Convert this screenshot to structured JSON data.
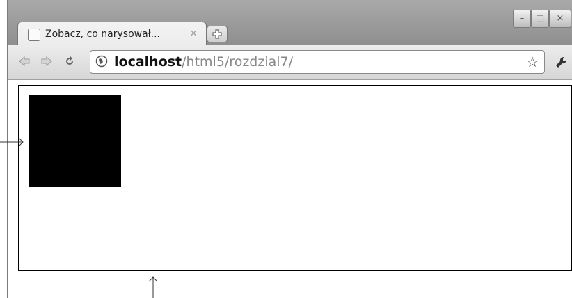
{
  "tab": {
    "title": "Zobacz, co narysował...",
    "close_label": "×"
  },
  "window_controls": {
    "minimize": "–",
    "maximize": "□",
    "close": "×"
  },
  "address_bar": {
    "host": "localhost",
    "path": "/html5/rozdzial7/"
  },
  "colors": {
    "chrome": "#9a9a9a",
    "toolbar": "#e2e2e2",
    "square": "#000000",
    "canvas_border": "#000000"
  }
}
